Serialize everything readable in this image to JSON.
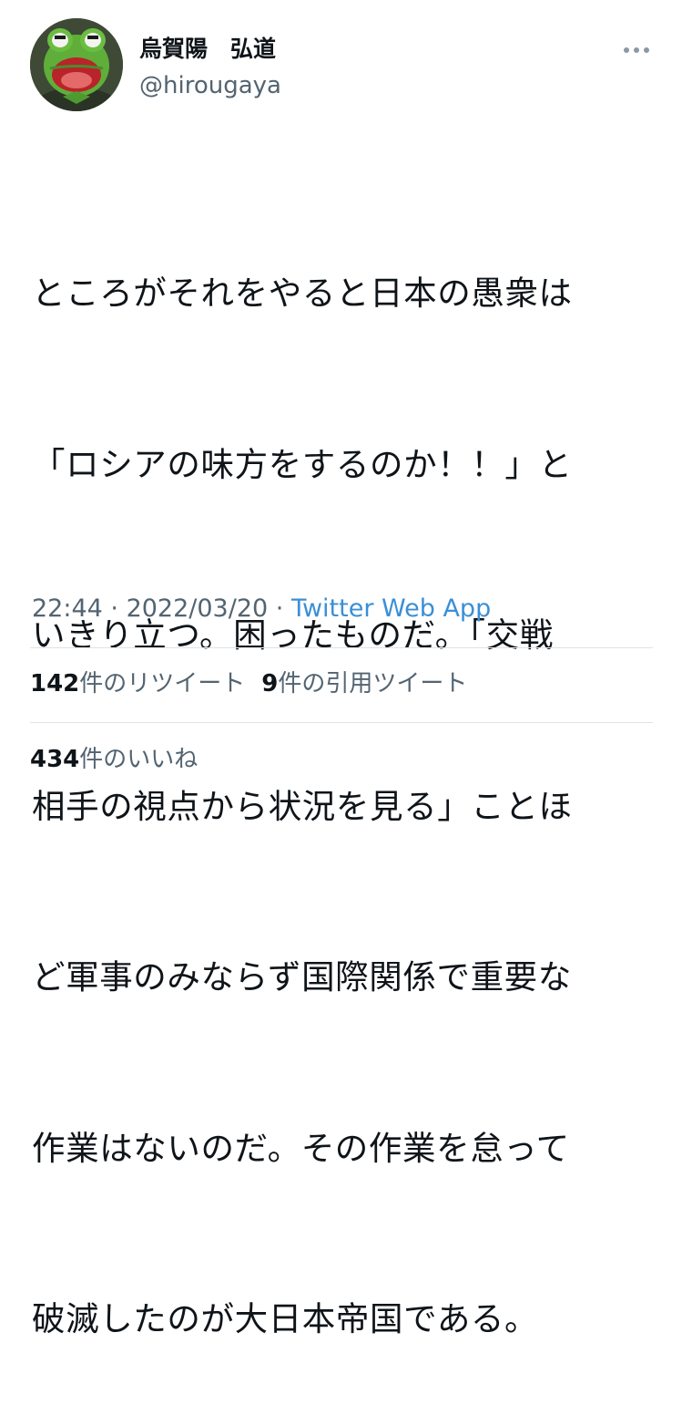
{
  "author": {
    "display_name": "烏賀陽　弘道",
    "handle": "@hirougaya",
    "avatar_icon": "kermit-avatar-icon"
  },
  "menu": {
    "icon": "more-horizontal-icon"
  },
  "tweet": {
    "lines": [
      "ところがそれをやると日本の愚衆は",
      "「ロシアの味方をするのか！！」と",
      "いきり立つ。困ったものだ。「交戦",
      "相手の視点から状況を見る」ことほ",
      "ど軍事のみならず国際関係で重要な",
      "作業はないのだ。その作業を怠って",
      "破滅したのが大日本帝国である。"
    ]
  },
  "meta": {
    "time": "22:44",
    "separator": " · ",
    "date": "2022/03/20",
    "source": "Twitter Web App"
  },
  "stats": {
    "retweets_count": "142",
    "retweets_label": "件のリツイート",
    "quotes_count": "9",
    "quotes_label": "件の引用ツイート",
    "likes_count": "434",
    "likes_label": "件のいいね"
  },
  "colors": {
    "text_primary": "#0f1419",
    "text_secondary": "#536471",
    "link": "#3b8fd6",
    "divider": "#dfe3e6"
  }
}
